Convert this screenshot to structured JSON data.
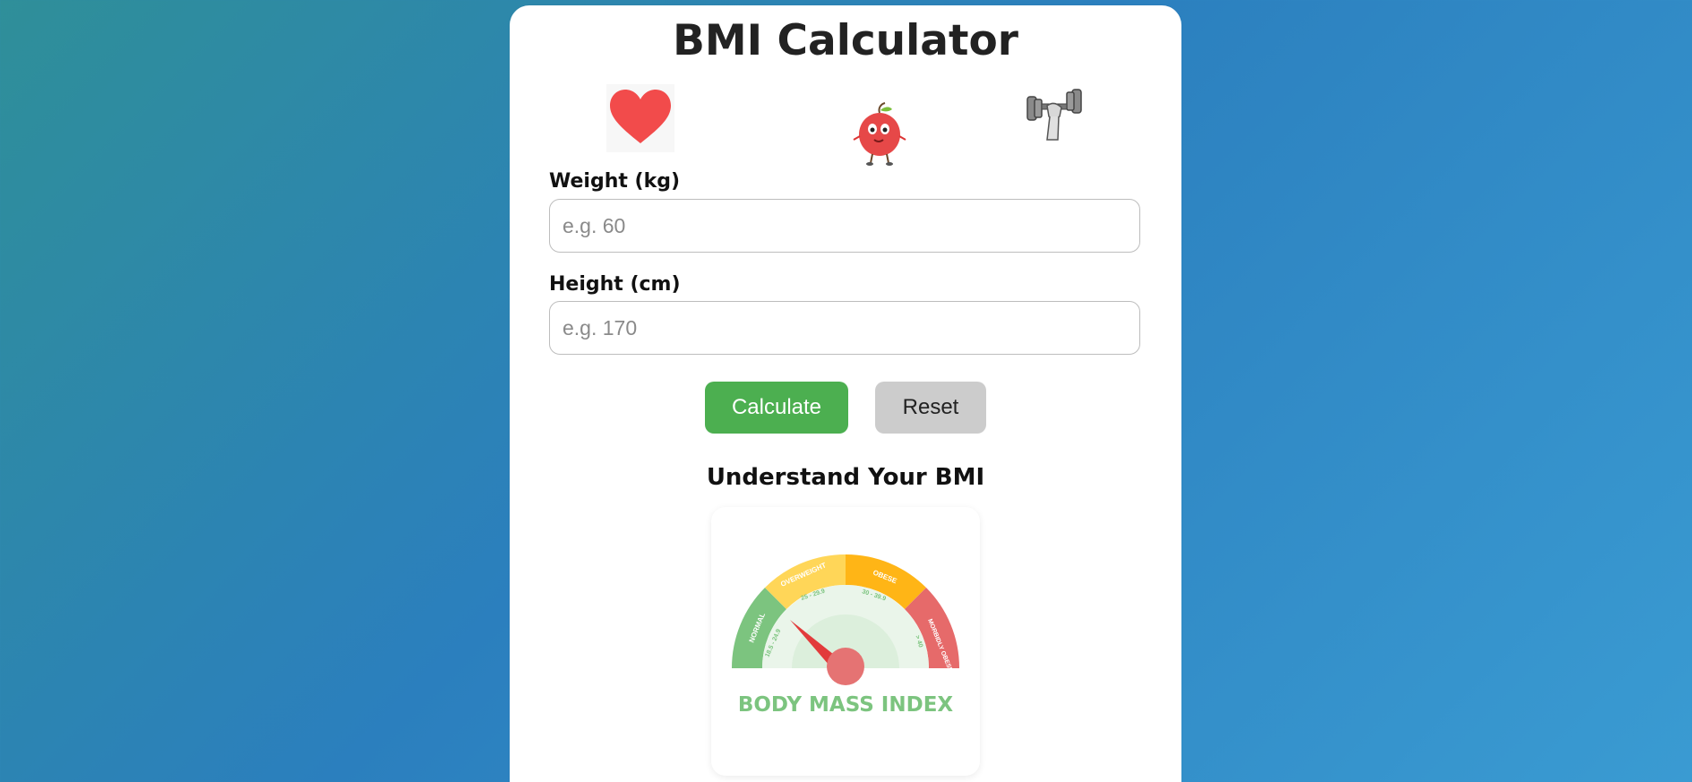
{
  "app": {
    "title": "BMI Calculator"
  },
  "icons": [
    "heart-icon",
    "apple-icon",
    "dumbbell-icon"
  ],
  "form": {
    "weight_label": "Weight (kg)",
    "weight_placeholder": "e.g. 60",
    "weight_value": "",
    "height_label": "Height (cm)",
    "height_placeholder": "e.g. 170",
    "height_value": ""
  },
  "buttons": {
    "calculate_label": "Calculate",
    "reset_label": "Reset"
  },
  "info": {
    "heading": "Understand Your BMI",
    "gauge": {
      "caption": "BODY MASS INDEX",
      "segments": [
        {
          "name": "NORMAL",
          "range": "18.5 - 24.9",
          "color": "#7cc47f"
        },
        {
          "name": "OVERWEIGHT",
          "range": "25 - 29.9",
          "color": "#ffd658"
        },
        {
          "name": "OBESE",
          "range": "30 - 39.9",
          "color": "#ffb516"
        },
        {
          "name": "MORBIDLY OBESE",
          "range": "> 40",
          "color": "#e66a6a"
        }
      ]
    }
  },
  "colors": {
    "primary_button": "#4caf50",
    "secondary_button": "#cccccc",
    "background_start": "#2f8f99",
    "background_end": "#3a9bd2"
  }
}
